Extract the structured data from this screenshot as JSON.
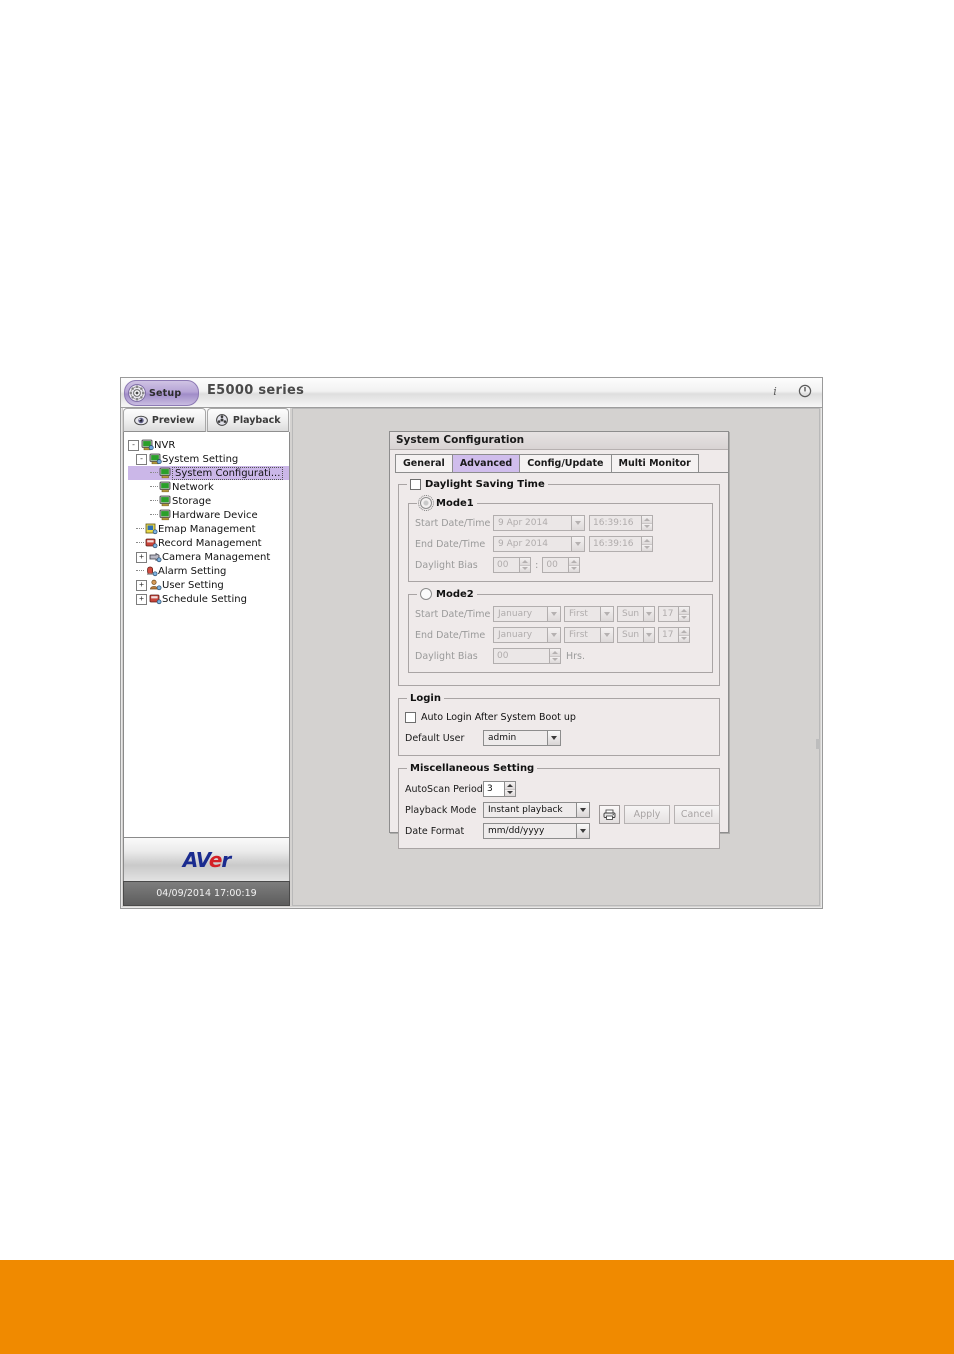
{
  "window": {
    "setup_button_label": "Setup",
    "app_title": "E5000 series",
    "titlebar_icons": [
      {
        "name": "info-icon",
        "glyph": "i"
      },
      {
        "name": "power-icon",
        "glyph": "power"
      }
    ]
  },
  "mode_tabs": [
    {
      "label": "Preview",
      "icon": "eye-icon"
    },
    {
      "label": "Playback",
      "icon": "film-reel-icon"
    }
  ],
  "tree": [
    {
      "label": "NVR",
      "level": 0,
      "expander": "-",
      "icon": "server-icon",
      "selected": false
    },
    {
      "label": "System Setting",
      "level": 1,
      "expander": "-",
      "icon": "system-setting-icon",
      "selected": false
    },
    {
      "label": "System Configurati...",
      "level": 2,
      "expander": "",
      "icon": "monitor-icon",
      "selected": true
    },
    {
      "label": "Network",
      "level": 2,
      "expander": "",
      "icon": "monitor-icon",
      "selected": false
    },
    {
      "label": "Storage",
      "level": 2,
      "expander": "",
      "icon": "monitor-icon",
      "selected": false
    },
    {
      "label": "Hardware Device",
      "level": 2,
      "expander": "",
      "icon": "monitor-icon",
      "selected": false
    },
    {
      "label": "Emap Management",
      "level": 1,
      "expander": "",
      "icon": "emap-icon",
      "selected": false
    },
    {
      "label": "Record Management",
      "level": 1,
      "expander": "",
      "icon": "record-icon",
      "selected": false
    },
    {
      "label": "Camera Management",
      "level": 1,
      "expander": "+",
      "icon": "camera-icon",
      "selected": false
    },
    {
      "label": "Alarm Setting",
      "level": 1,
      "expander": "",
      "icon": "alarm-icon",
      "selected": false
    },
    {
      "label": "User Setting",
      "level": 1,
      "expander": "+",
      "icon": "user-icon",
      "selected": false
    },
    {
      "label": "Schedule Setting",
      "level": 1,
      "expander": "+",
      "icon": "schedule-icon",
      "selected": false
    }
  ],
  "branding": {
    "logo_a": "AV",
    "logo_e": "e",
    "logo_r": "r",
    "logo_full": "AVer",
    "status_datetime": "04/09/2014 17:00:19"
  },
  "dialog": {
    "title": "System Configuration",
    "tabs": [
      {
        "label": "General",
        "active": false
      },
      {
        "label": "Advanced",
        "active": true
      },
      {
        "label": "Config/Update",
        "active": false
      },
      {
        "label": "Multi Monitor",
        "active": false
      }
    ],
    "daylight_saving": {
      "legend": "Daylight Saving Time",
      "checked": false,
      "mode1": {
        "legend": "Mode1",
        "selected": true,
        "start_label": "Start Date/Time",
        "start_date": "9 Apr 2014",
        "start_time": "16:39:16",
        "end_label": "End Date/Time",
        "end_date": "9 Apr 2014",
        "end_time": "16:39:16",
        "bias_label": "Daylight Bias",
        "bias_hours": "00",
        "bias_minutes": "00",
        "bias_separator": ":"
      },
      "mode2": {
        "legend": "Mode2",
        "selected": false,
        "start_label": "Start Date/Time",
        "start_month": "January",
        "start_week": "First",
        "start_day": "Sun",
        "start_hour": "17",
        "end_label": "End Date/Time",
        "end_month": "January",
        "end_week": "First",
        "end_day": "Sun",
        "end_hour": "17",
        "bias_label": "Daylight Bias",
        "bias_value": "00",
        "bias_unit": "Hrs."
      }
    },
    "login": {
      "legend": "Login",
      "auto_login_label": "Auto Login After System Boot up",
      "auto_login_checked": false,
      "default_user_label": "Default User",
      "default_user_value": "admin"
    },
    "misc": {
      "legend": "Miscellaneous Setting",
      "autoscan_label": "AutoScan Period",
      "autoscan_value": "3",
      "playback_mode_label": "Playback Mode",
      "playback_mode_value": "Instant playback",
      "date_format_label": "Date Format",
      "date_format_value": "mm/dd/yyyy"
    },
    "footer": {
      "print_icon": "printer-icon",
      "apply_label": "Apply",
      "cancel_label": "Cancel"
    }
  },
  "colors": {
    "accent_purple": "#b6a4d6",
    "selection_purple": "#cbb7e8",
    "page_orange": "#f08a00",
    "dialog_bg": "#efeaea"
  }
}
